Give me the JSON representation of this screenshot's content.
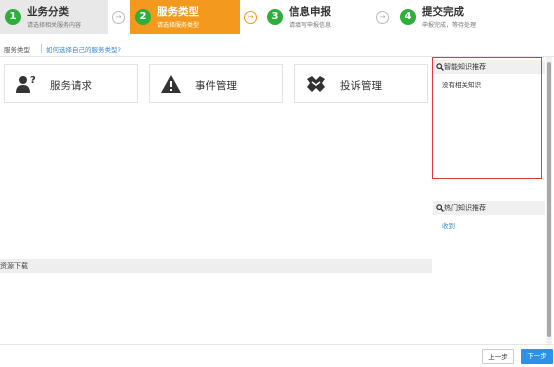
{
  "steps": [
    {
      "num": "1",
      "title": "业务分类",
      "sub": "请选择相关服务内容"
    },
    {
      "num": "2",
      "title": "服务类型",
      "sub": "请选择服务类型"
    },
    {
      "num": "3",
      "title": "信息申报",
      "sub": "请填写申报信息"
    },
    {
      "num": "4",
      "title": "提交完成",
      "sub": "申报完成，等待处理"
    }
  ],
  "step_arrow_glyph": "→",
  "colors": {
    "active_step": "#f39a1e",
    "done_step": "#e8e8e8",
    "step_num_green": "#2eae3a",
    "next_button": "#2a92ea",
    "highlight_box": "#e4393c"
  },
  "tabbar": {
    "label": "服务类型",
    "link": "如何选择自己的服务类型?"
  },
  "service_cards": [
    {
      "icon": "user-question-icon",
      "label": "服务请求"
    },
    {
      "icon": "warning-icon",
      "label": "事件管理"
    },
    {
      "icon": "handshake-icon",
      "label": "投诉管理"
    }
  ],
  "smart_kb": {
    "title": "智能知识推荐",
    "empty": "没有相关知识"
  },
  "hot_kb": {
    "title": "热门知识推荐",
    "item": "收到"
  },
  "resources": {
    "title": "资源下载"
  },
  "buttons": {
    "prev": "上一步",
    "next": "下一步"
  }
}
